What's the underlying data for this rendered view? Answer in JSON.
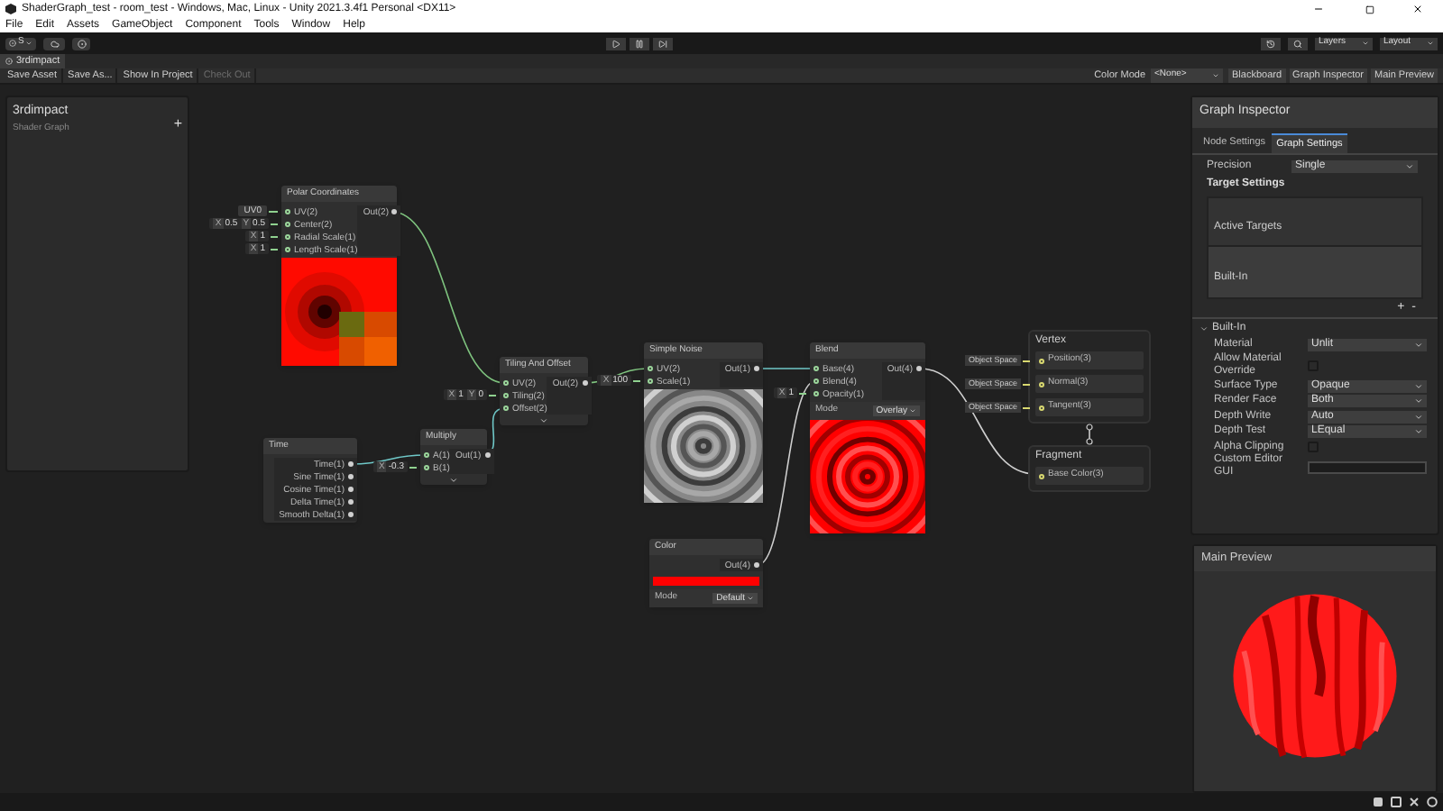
{
  "window": {
    "title": "ShaderGraph_test - room_test - Windows, Mac, Linux - Unity 2021.3.4f1 Personal <DX11>"
  },
  "menu": [
    "File",
    "Edit",
    "Assets",
    "GameObject",
    "Component",
    "Tools",
    "Window",
    "Help"
  ],
  "toolbar": {
    "account": "S",
    "layers": "Layers",
    "layout": "Layout"
  },
  "tab": {
    "label": "3rdimpact"
  },
  "graph_toolbar": {
    "buttons": [
      {
        "label": "Save Asset",
        "disabled": false
      },
      {
        "label": "Save As...",
        "disabled": false
      },
      {
        "label": "Show In Project",
        "disabled": false
      },
      {
        "label": "Check Out",
        "disabled": true
      }
    ],
    "color_mode_label": "Color Mode",
    "color_mode": "<None>",
    "toggles": [
      "Blackboard",
      "Graph Inspector",
      "Main Preview"
    ]
  },
  "blackboard": {
    "title": "3rdimpact",
    "subtitle": "Shader Graph",
    "add": "+"
  },
  "nodes": [
    {
      "title": "Polar Coordinates",
      "preview": true,
      "inputs": [
        {
          "label": "UV(2)",
          "field": {
            "kind": "dropdown",
            "value": "UV0"
          }
        },
        {
          "label": "Center(2)",
          "field": {
            "kind": "vector",
            "parts": [
              {
                "axis": "X",
                "value": "0.5"
              },
              {
                "axis": "Y",
                "value": "0.5"
              }
            ]
          }
        },
        {
          "label": "Radial Scale(1)",
          "field": {
            "kind": "vector",
            "parts": [
              {
                "axis": "X",
                "value": "1"
              }
            ]
          }
        },
        {
          "label": "Length Scale(1)",
          "field": {
            "kind": "vector",
            "parts": [
              {
                "axis": "X",
                "value": "1"
              }
            ]
          }
        }
      ],
      "outputs": [
        "Out(2)"
      ]
    },
    {
      "title": "Time",
      "outputs": [
        "Time(1)",
        "Sine Time(1)",
        "Cosine Time(1)",
        "Delta Time(1)",
        "Smooth Delta(1)"
      ]
    },
    {
      "title": "Multiply",
      "collapsible": true,
      "inputs": [
        {
          "label": "A(1)"
        },
        {
          "label": "B(1)",
          "field": {
            "kind": "vector",
            "parts": [
              {
                "axis": "X",
                "value": "-0.3"
              }
            ]
          }
        }
      ],
      "outputs": [
        "Out(1)"
      ]
    },
    {
      "title": "Tiling And Offset",
      "collapsible": true,
      "inputs": [
        {
          "label": "UV(2)"
        },
        {
          "label": "Tiling(2)",
          "field": {
            "kind": "vector",
            "parts": [
              {
                "axis": "X",
                "value": "1"
              },
              {
                "axis": "Y",
                "value": "0"
              }
            ]
          }
        },
        {
          "label": "Offset(2)"
        }
      ],
      "outputs": [
        "Out(2)"
      ]
    },
    {
      "title": "Simple Noise",
      "preview": true,
      "inputs": [
        {
          "label": "UV(2)"
        },
        {
          "label": "Scale(1)",
          "field": {
            "kind": "vector",
            "parts": [
              {
                "axis": "X",
                "value": "100"
              }
            ]
          }
        }
      ],
      "outputs": [
        "Out(1)"
      ]
    },
    {
      "title": "Blend",
      "preview": true,
      "mode": {
        "label": "Mode",
        "value": "Overlay"
      },
      "inputs": [
        {
          "label": "Base(4)"
        },
        {
          "label": "Blend(4)"
        },
        {
          "label": "Opacity(1)",
          "field": {
            "kind": "vector",
            "parts": [
              {
                "axis": "X",
                "value": "1"
              }
            ]
          }
        }
      ],
      "outputs": [
        "Out(4)"
      ]
    },
    {
      "title": "Color",
      "color": "#ff0000",
      "mode": {
        "label": "Mode",
        "value": "Default"
      },
      "outputs": [
        "Out(4)"
      ]
    }
  ],
  "contexts": [
    {
      "title": "Vertex",
      "blocks": [
        {
          "label": "Position(3)",
          "space": "Object Space"
        },
        {
          "label": "Normal(3)",
          "space": "Object Space"
        },
        {
          "label": "Tangent(3)",
          "space": "Object Space"
        }
      ]
    },
    {
      "title": "Fragment",
      "blocks": [
        {
          "label": "Base Color(3)"
        }
      ]
    }
  ],
  "inspector": {
    "title": "Graph Inspector",
    "tabs": [
      {
        "label": "Node Settings",
        "selected": false
      },
      {
        "label": "Graph Settings",
        "selected": true
      }
    ],
    "precision": {
      "label": "Precision",
      "value": "Single"
    },
    "target_settings": "Target Settings",
    "active_targets": {
      "title": "Active Targets",
      "items": [
        "Built-In"
      ]
    },
    "add": "+",
    "remove": "-",
    "section": {
      "label": "Built-In",
      "expanded": true,
      "rows": [
        {
          "kind": "dropdown",
          "label": "Material",
          "value": "Unlit"
        },
        {
          "kind": "checkbox",
          "label": "Allow Material Override",
          "checked": false
        },
        {
          "kind": "dropdown",
          "label": "Surface Type",
          "value": "Opaque"
        },
        {
          "kind": "dropdown",
          "label": "Render Face",
          "value": "Both"
        },
        {
          "kind": "dropdown",
          "label": "Depth Write",
          "value": "Auto"
        },
        {
          "kind": "dropdown",
          "label": "Depth Test",
          "value": "LEqual"
        },
        {
          "kind": "checkbox",
          "label": "Alpha Clipping",
          "checked": false
        },
        {
          "kind": "text",
          "label": "Custom Editor GUI"
        }
      ]
    }
  },
  "main_preview": {
    "title": "Main Preview"
  }
}
